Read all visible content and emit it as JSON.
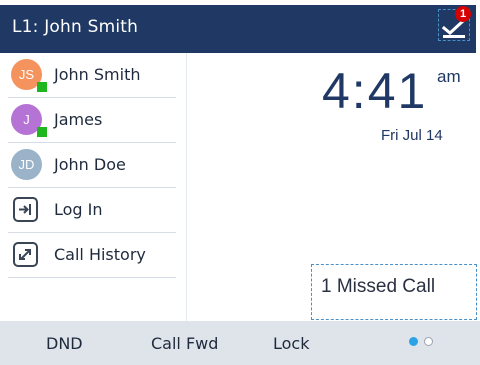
{
  "header": {
    "line_title": "L1: John Smith",
    "message_badge": "1",
    "icon": "voicemail-check-icon",
    "background": "#1f3864"
  },
  "contacts": [
    {
      "initials": "JS",
      "name": "John Smith",
      "avatar_color": "#f4935e",
      "presence": "available"
    },
    {
      "initials": "J",
      "name": "James",
      "avatar_color": "#b673d6",
      "presence": "available"
    },
    {
      "initials": "JD",
      "name": "John Doe",
      "avatar_color": "#9ab3c9",
      "presence": "none"
    }
  ],
  "actions": [
    {
      "label": "Log In",
      "icon": "login-icon"
    },
    {
      "label": "Call History",
      "icon": "call-history-icon"
    }
  ],
  "clock": {
    "time": "4:41",
    "ampm": "am",
    "date": "Fri Jul 14"
  },
  "notification": {
    "missed_call": "1  Missed Call"
  },
  "softkeys": [
    "DND",
    "Call Fwd",
    "Lock"
  ],
  "pagination": {
    "pages": 2,
    "current": 1
  },
  "colors": {
    "presence_available": "#1fb61e",
    "accent": "#2aa4e6",
    "softkey_bar": "#dfe3ea"
  }
}
